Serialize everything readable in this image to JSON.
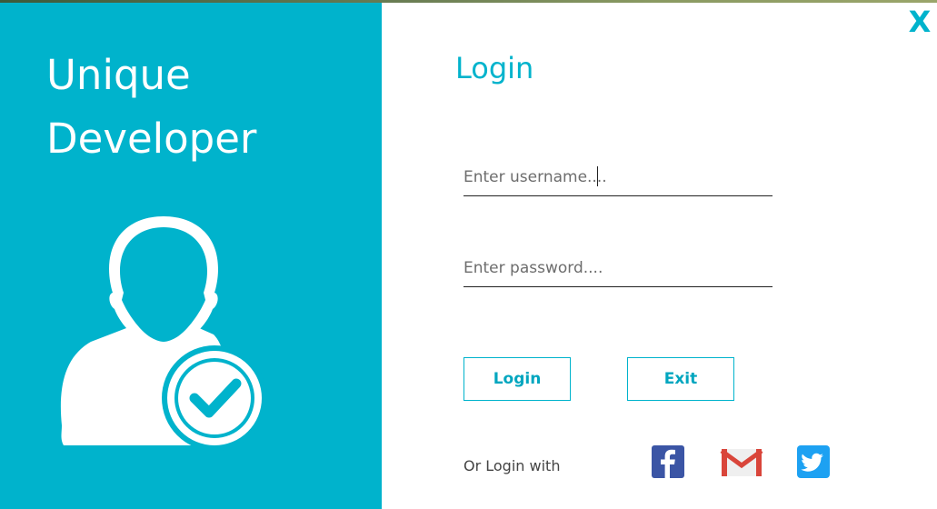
{
  "brand": {
    "title_line1": "Unique",
    "title_line2": "Developer"
  },
  "login": {
    "heading": "Login",
    "username_placeholder": "Enter username....",
    "password_placeholder": "Enter password....",
    "login_button": "Login",
    "exit_button": "Exit",
    "or_login_with": "Or Login with"
  },
  "close_label": "X",
  "social": {
    "facebook_icon": "facebook-icon",
    "gmail_icon": "gmail-icon",
    "twitter_icon": "twitter-icon"
  },
  "colors": {
    "accent": "#00b3cc",
    "panel_text": "#ffffff",
    "facebook": "#3b55a5",
    "gmail_red": "#d9453a",
    "twitter": "#1da1f2"
  }
}
